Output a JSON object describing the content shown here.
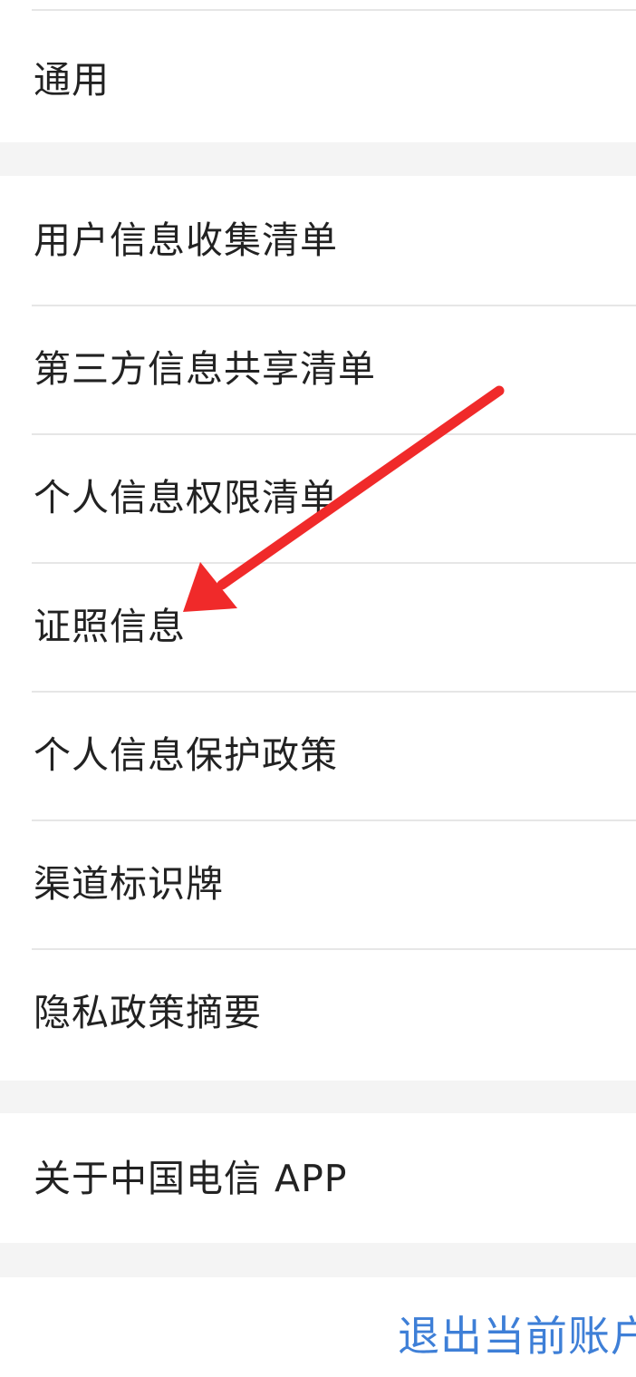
{
  "menu": {
    "general": "通用",
    "group2": [
      {
        "key": "user-info-collection",
        "label": "用户信息收集清单"
      },
      {
        "key": "third-party-sharing",
        "label": "第三方信息共享清单"
      },
      {
        "key": "personal-permissions",
        "label": "个人信息权限清单"
      },
      {
        "key": "license-info",
        "label": "证照信息"
      },
      {
        "key": "privacy-protection",
        "label": "个人信息保护政策"
      },
      {
        "key": "channel-sign",
        "label": "渠道标识牌"
      },
      {
        "key": "privacy-summary",
        "label": "隐私政策摘要"
      }
    ],
    "about": "关于中国电信 APP"
  },
  "logout": {
    "label": "退出当前账户"
  },
  "annotation": {
    "arrow_color": "#f02a2a"
  }
}
